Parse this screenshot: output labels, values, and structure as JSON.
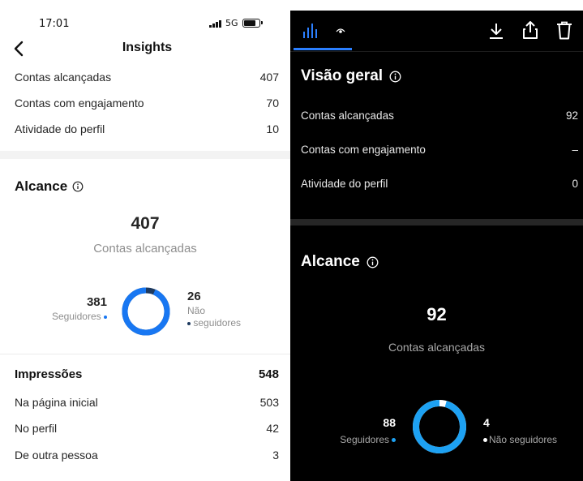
{
  "colors": {
    "accent_blue": "#1877f2",
    "dark_accent_blue": "#1da1f2",
    "light_bg": "#ffffff",
    "dark_bg": "#000000"
  },
  "left": {
    "status": {
      "time": "17:01",
      "network": "5G"
    },
    "nav": {
      "title": "Insights"
    },
    "overview": [
      {
        "label": "Contas alcançadas",
        "value": "407"
      },
      {
        "label": "Contas com engajamento",
        "value": "70"
      },
      {
        "label": "Atividade do perfil",
        "value": "10"
      }
    ],
    "reach": {
      "title": "Alcance",
      "total": "407",
      "total_label": "Contas alcançadas",
      "followers_value": "381",
      "followers_label": "Seguidores",
      "non_followers_value": "26",
      "non_followers_label_1": "Não",
      "non_followers_label_2": "seguidores",
      "followers_fraction": 0.936
    },
    "impressions": {
      "title": "Impressões",
      "total": "548",
      "rows": [
        {
          "label": "Na página inicial",
          "value": "503"
        },
        {
          "label": "No perfil",
          "value": "42"
        },
        {
          "label": "De outra pessoa",
          "value": "3"
        }
      ]
    }
  },
  "right": {
    "toolbar": {
      "icons": [
        "insights-bars-icon",
        "eye-icon",
        "download-icon",
        "share-icon",
        "trash-icon"
      ]
    },
    "overview": {
      "title": "Visão geral",
      "rows": [
        {
          "label": "Contas alcançadas",
          "value": "92"
        },
        {
          "label": "Contas com engajamento",
          "value": "–"
        },
        {
          "label": "Atividade do perfil",
          "value": "0"
        }
      ]
    },
    "reach": {
      "title": "Alcance",
      "total": "92",
      "total_label": "Contas alcançadas",
      "followers_value": "88",
      "followers_label": "Seguidores",
      "non_followers_value": "4",
      "non_followers_label": "Não seguidores",
      "followers_fraction": 0.957
    }
  }
}
